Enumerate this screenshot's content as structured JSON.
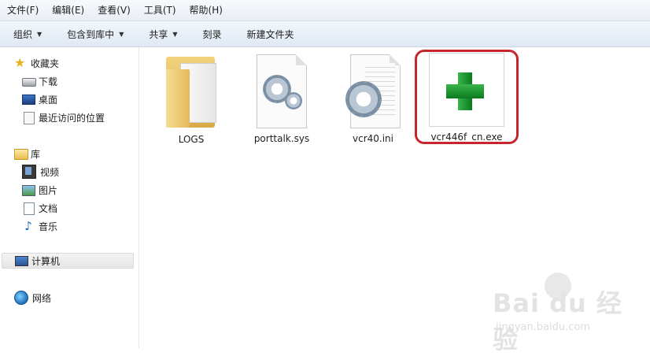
{
  "menubar": {
    "items": [
      "文件(F)",
      "编辑(E)",
      "查看(V)",
      "工具(T)",
      "帮助(H)"
    ]
  },
  "toolbar": {
    "organize": "组织",
    "include_in_library": "包含到库中",
    "share": "共享",
    "burn": "刻录",
    "new_folder": "新建文件夹"
  },
  "nav": {
    "favorites": "收藏夹",
    "downloads": "下载",
    "desktop": "桌面",
    "recent": "最近访问的位置",
    "libraries": "库",
    "videos": "视频",
    "pictures": "图片",
    "documents": "文档",
    "music": "音乐",
    "computer": "计算机",
    "network": "网络"
  },
  "files": [
    {
      "name": "LOGS",
      "icon": "folder-icon"
    },
    {
      "name": "porttalk.sys",
      "icon": "system-file-icon"
    },
    {
      "name": "vcr40.ini",
      "icon": "settings-file-icon"
    },
    {
      "name": "vcr446f_cn.exe",
      "icon": "executable-icon"
    }
  ],
  "watermark": {
    "brand": "Bai du 经验",
    "url": "jingyan.baidu.com"
  },
  "colors": {
    "highlight": "#c5272c",
    "exe_cross": "#1a9a2e",
    "folder": "#e4b957"
  }
}
